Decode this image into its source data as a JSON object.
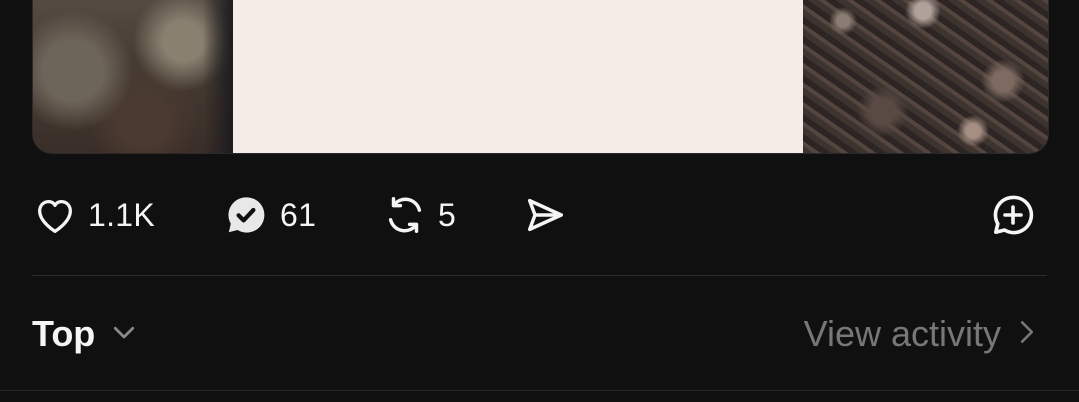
{
  "post": {
    "actions": {
      "like_count": "1.1K",
      "reply_count": "61",
      "repost_count": "5",
      "like_icon": "heart-icon",
      "reply_icon": "reply-bubble-check-icon",
      "repost_icon": "repost-icon",
      "share_icon": "send-icon",
      "quote_icon": "quote-plus-icon"
    }
  },
  "replies": {
    "sort_label": "Top",
    "sort_icon": "chevron-down-icon",
    "activity_label": "View activity",
    "activity_icon": "chevron-right-icon"
  },
  "colors": {
    "background": "#101010",
    "text_primary": "#f3f5f7",
    "text_secondary": "#777777",
    "divider": "#2e2e2e"
  }
}
